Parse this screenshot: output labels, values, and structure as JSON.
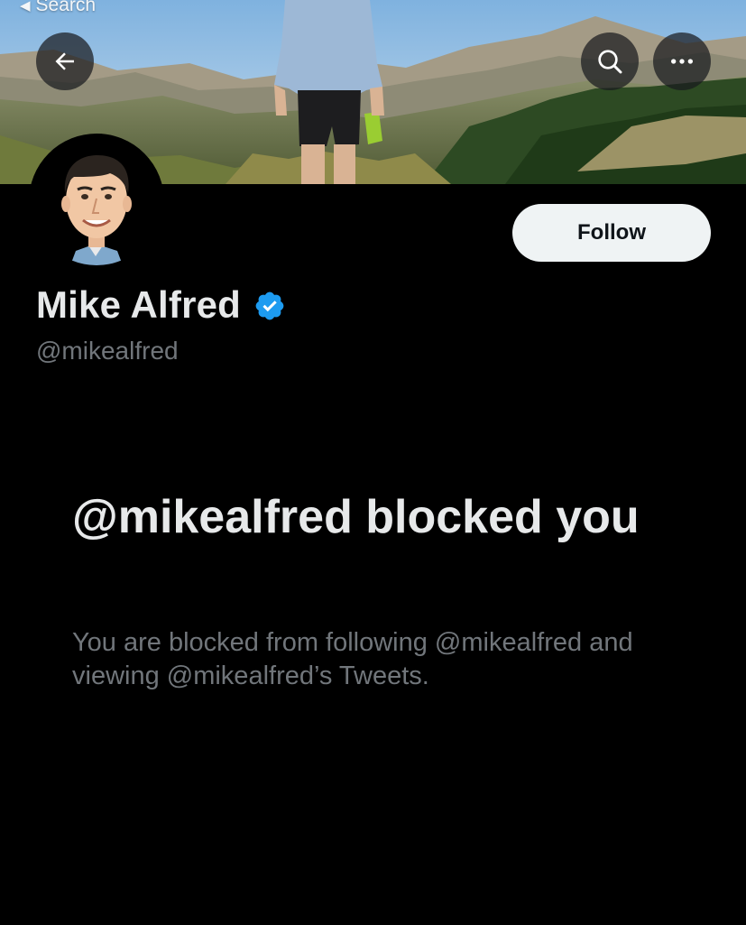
{
  "status_bar": {
    "back_label": "Search"
  },
  "header": {
    "back_icon": "arrow-left-icon",
    "search_icon": "search-icon",
    "more_icon": "more-horizontal-icon"
  },
  "profile": {
    "display_name": "Mike Alfred",
    "handle": "@mikealfred",
    "verified": true,
    "follow_label": "Follow"
  },
  "blocked_notice": {
    "title": "@mikealfred blocked you",
    "description": "You are blocked from following @mikealfred and viewing @mikealfred’s Tweets."
  },
  "colors": {
    "background": "#000000",
    "primary_text": "#e7e9ea",
    "secondary_text": "#71767b",
    "verified_blue": "#1d9bf0",
    "follow_button_bg": "#eff3f4"
  }
}
